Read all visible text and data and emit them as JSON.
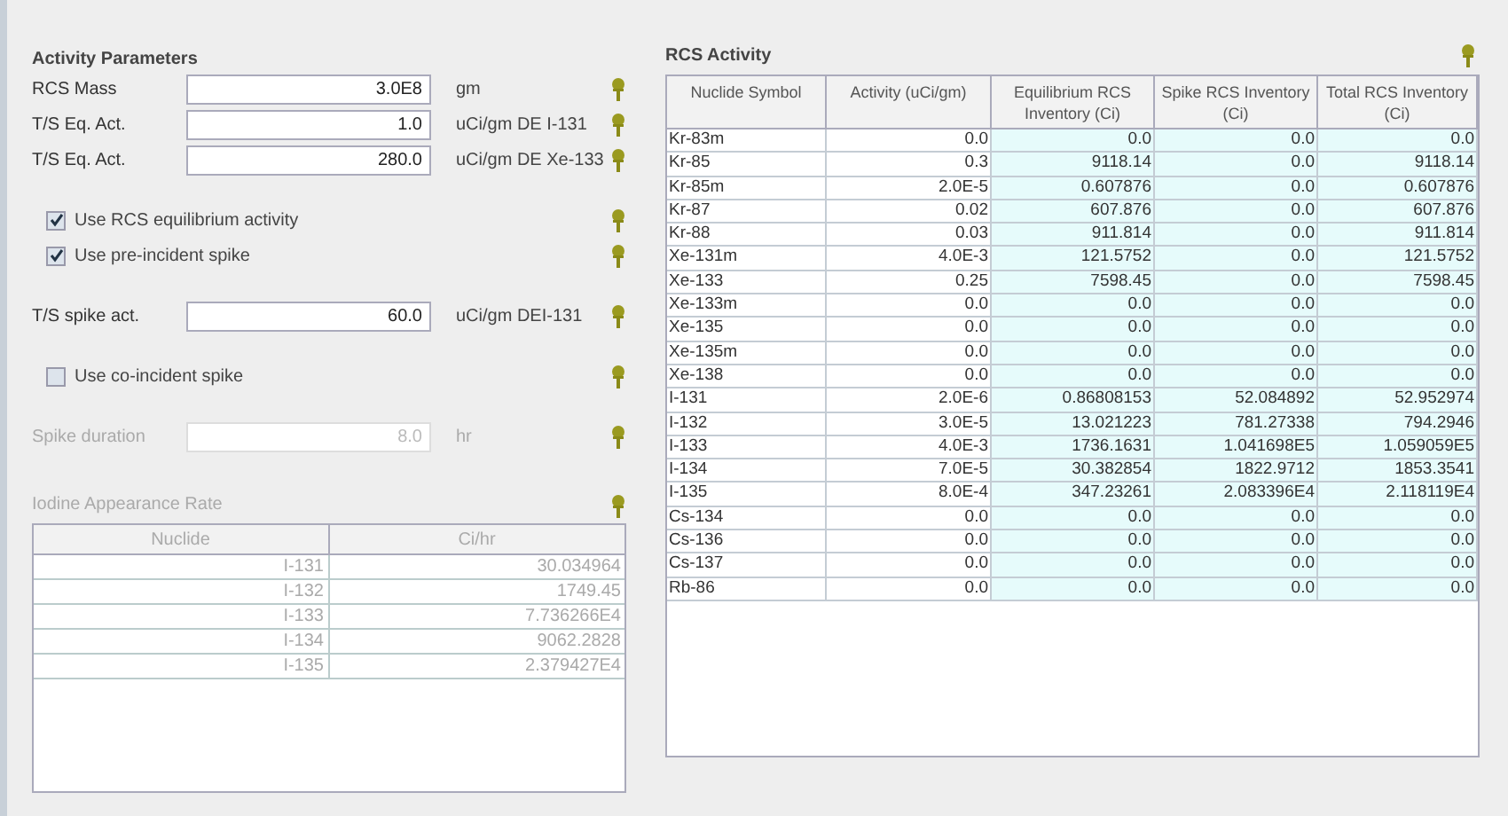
{
  "activity_parameters": {
    "title": "Activity Parameters",
    "items": [
      {
        "kind": "field",
        "label": "RCS Mass",
        "value": "3.0E8",
        "unit": "gm",
        "disabled": false
      },
      {
        "kind": "field",
        "label": "T/S Eq. Act.",
        "value": "1.0",
        "unit": "uCi/gm DE I-131",
        "disabled": false
      },
      {
        "kind": "field",
        "label": "T/S Eq. Act.",
        "value": "280.0",
        "unit": "uCi/gm DE Xe-133",
        "disabled": false
      },
      {
        "kind": "checkbox",
        "label": "Use RCS equilibrium activity",
        "checked": true
      },
      {
        "kind": "checkbox",
        "label": "Use pre-incident spike",
        "checked": true
      },
      {
        "kind": "field",
        "label": "T/S spike act.",
        "value": "60.0",
        "unit": "uCi/gm DEI-131",
        "disabled": false
      },
      {
        "kind": "checkbox",
        "label": "Use co-incident spike",
        "checked": false
      },
      {
        "kind": "field",
        "label": "Spike duration",
        "value": "8.0",
        "unit": "hr",
        "disabled": true
      }
    ]
  },
  "iodine_appearance_rate": {
    "title": "Iodine Appearance Rate",
    "disabled": true,
    "columns": [
      "Nuclide",
      "Ci/hr"
    ],
    "rows": [
      [
        "I-131",
        "30.034964"
      ],
      [
        "I-132",
        "1749.45"
      ],
      [
        "I-133",
        "7.736266E4"
      ],
      [
        "I-134",
        "9062.2828"
      ],
      [
        "I-135",
        "2.379427E4"
      ]
    ]
  },
  "rcs_activity": {
    "title": "RCS Activity",
    "columns": [
      "Nuclide Symbol",
      "Activity (uCi/gm)",
      "Equilibrium RCS Inventory (Ci)",
      "Spike RCS Inventory (Ci)",
      "Total RCS Inventory (Ci)"
    ],
    "rows": [
      [
        "Kr-83m",
        "0.0",
        "0.0",
        "0.0",
        "0.0"
      ],
      [
        "Kr-85",
        "0.3",
        "9118.14",
        "0.0",
        "9118.14"
      ],
      [
        "Kr-85m",
        "2.0E-5",
        "0.607876",
        "0.0",
        "0.607876"
      ],
      [
        "Kr-87",
        "0.02",
        "607.876",
        "0.0",
        "607.876"
      ],
      [
        "Kr-88",
        "0.03",
        "911.814",
        "0.0",
        "911.814"
      ],
      [
        "Xe-131m",
        "4.0E-3",
        "121.5752",
        "0.0",
        "121.5752"
      ],
      [
        "Xe-133",
        "0.25",
        "7598.45",
        "0.0",
        "7598.45"
      ],
      [
        "Xe-133m",
        "0.0",
        "0.0",
        "0.0",
        "0.0"
      ],
      [
        "Xe-135",
        "0.0",
        "0.0",
        "0.0",
        "0.0"
      ],
      [
        "Xe-135m",
        "0.0",
        "0.0",
        "0.0",
        "0.0"
      ],
      [
        "Xe-138",
        "0.0",
        "0.0",
        "0.0",
        "0.0"
      ],
      [
        "I-131",
        "2.0E-6",
        "0.86808153",
        "52.084892",
        "52.952974"
      ],
      [
        "I-132",
        "3.0E-5",
        "13.021223",
        "781.27338",
        "794.2946"
      ],
      [
        "I-133",
        "4.0E-3",
        "1736.1631",
        "1.041698E5",
        "1.059059E5"
      ],
      [
        "I-134",
        "7.0E-5",
        "30.382854",
        "1822.9712",
        "1853.3541"
      ],
      [
        "I-135",
        "8.0E-4",
        "347.23261",
        "2.083396E4",
        "2.118119E4"
      ],
      [
        "Cs-134",
        "0.0",
        "0.0",
        "0.0",
        "0.0"
      ],
      [
        "Cs-136",
        "0.0",
        "0.0",
        "0.0",
        "0.0"
      ],
      [
        "Cs-137",
        "0.0",
        "0.0",
        "0.0",
        "0.0"
      ],
      [
        "Rb-86",
        "0.0",
        "0.0",
        "0.0",
        "0.0"
      ]
    ]
  }
}
